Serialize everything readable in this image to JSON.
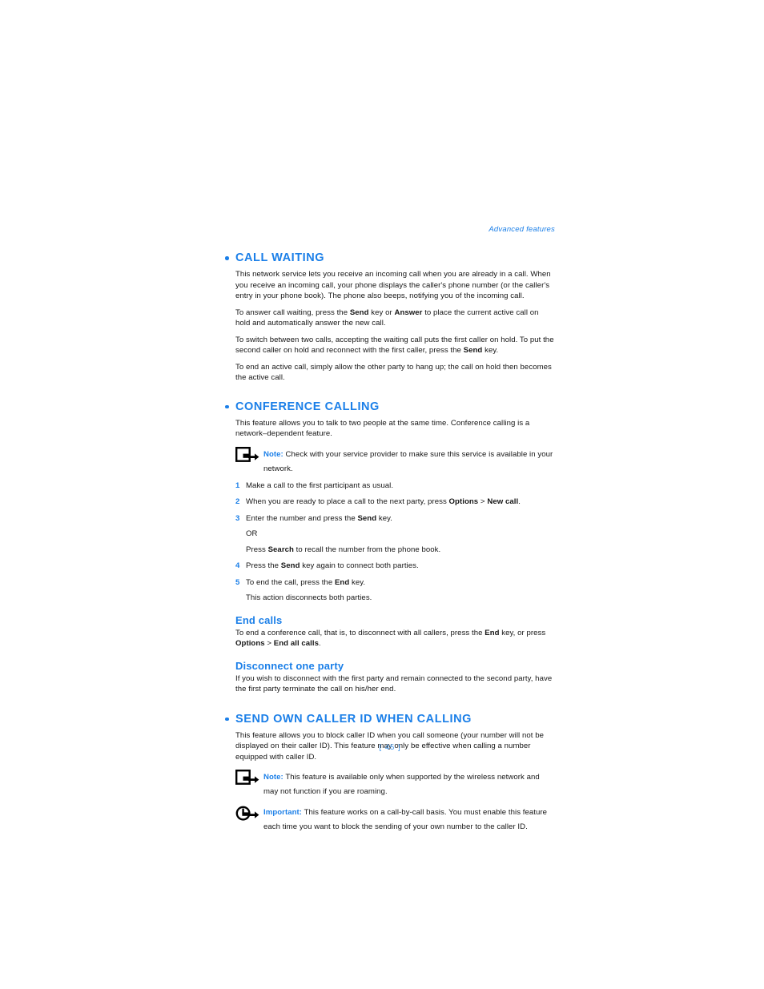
{
  "page": {
    "running_header": "Advanced features",
    "page_number": "[ 45 ]"
  },
  "sections": [
    {
      "id": "call-waiting",
      "heading": "CALL WAITING",
      "paragraphs": [
        "This network service lets you receive an incoming call when you are already in a call. When you receive an incoming call, your phone displays the caller's phone number (or the caller's entry in your phone book). The phone also beeps, notifying you of the incoming call.",
        "To answer call waiting, press the Send key or Answer to place the current active call on hold and automatically answer the new call.",
        "To switch between two calls, accepting the waiting call puts the first caller on hold. To put the second caller on hold and reconnect with the first caller, press the Send key.",
        "To end an active call, simply allow the other party to hang up; the call on hold then becomes the active call."
      ]
    },
    {
      "id": "conference-calling",
      "heading": "CONFERENCE CALLING",
      "intro": "This feature allows you to talk to two people at the same time. Conference calling is a network–dependent feature.",
      "note": {
        "icon": "note-arrow-box-icon",
        "label": "Note:",
        "text": " Check with your service provider to make sure this service is available in your network."
      },
      "steps": [
        {
          "num": "1",
          "text": "Make a call to the first participant as usual."
        },
        {
          "num": "2",
          "text": "When you are ready to place a call to the next party, press Options > New call."
        },
        {
          "num": "3",
          "text": "Enter the number and press the Send key.",
          "or": "OR",
          "alt": "Press Search to recall the number from the phone book."
        },
        {
          "num": "4",
          "text": "Press the Send key again to connect both parties."
        },
        {
          "num": "5",
          "text": "To end the call, press the End key.",
          "follow": "This action disconnects both parties."
        }
      ],
      "subsections": [
        {
          "id": "end-calls",
          "heading": "End calls",
          "body": "To end a conference call, that is, to disconnect with all callers, press the End key, or press Options > End all calls."
        },
        {
          "id": "disconnect-one-party",
          "heading": "Disconnect one party",
          "body": "If you wish to disconnect with the first party and remain connected to the second party, have the first party terminate the call on his/her end."
        }
      ]
    },
    {
      "id": "send-own-caller-id",
      "heading": "SEND OWN CALLER ID WHEN CALLING",
      "intro": "This feature allows you to block caller ID when you call someone (your number will not be displayed on their caller ID). This feature may only be effective when calling a number equipped with caller ID.",
      "note": {
        "icon": "note-arrow-box-icon",
        "label": "Note:",
        "text": " This feature is available only when supported by the wireless network and may not function if you are roaming."
      },
      "important": {
        "icon": "important-arrow-circle-icon",
        "label": "Important:",
        "text": " This feature works on a call-by-call basis. You must enable this feature each time you want to block the sending of your own number to the caller ID."
      }
    }
  ],
  "colors": {
    "accent_blue": "#1b7fe8",
    "page_number_blue": "#3b93ea",
    "body_text": "#161616",
    "background": "#ffffff"
  }
}
